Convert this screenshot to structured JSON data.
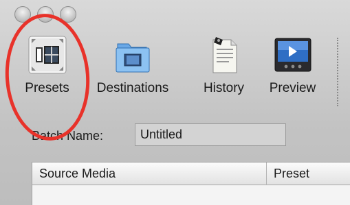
{
  "toolbar": {
    "items": [
      {
        "label": "Presets",
        "icon": "presets-icon"
      },
      {
        "label": "Destinations",
        "icon": "destinations-folder-icon"
      },
      {
        "label": "History",
        "icon": "history-document-icon"
      },
      {
        "label": "Preview",
        "icon": "preview-monitor-icon"
      }
    ]
  },
  "batch": {
    "label": "Batch Name:",
    "value": "Untitled"
  },
  "table": {
    "columns": [
      "Source Media",
      "Preset"
    ]
  },
  "colors": {
    "annotation": "#e8322a",
    "window_bg": "#c8c8c8"
  }
}
